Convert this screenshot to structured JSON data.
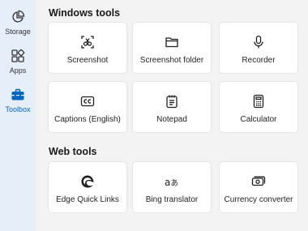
{
  "sidebar": {
    "items": [
      {
        "label": "Storage",
        "icon": "pie-chart-icon",
        "active": false
      },
      {
        "label": "Apps",
        "icon": "apps-grid-icon",
        "active": false
      },
      {
        "label": "Toolbox",
        "icon": "toolbox-icon",
        "active": true
      }
    ]
  },
  "windows_tools": {
    "title": "Windows tools",
    "tiles": [
      {
        "label": "Screenshot",
        "icon": "screenshot-icon"
      },
      {
        "label": "Screenshot folder",
        "icon": "folder-icon"
      },
      {
        "label": "Recorder",
        "icon": "microphone-icon"
      },
      {
        "label": "Captions (English)",
        "icon": "captions-icon"
      },
      {
        "label": "Notepad",
        "icon": "notepad-icon"
      },
      {
        "label": "Calculator",
        "icon": "calculator-icon"
      }
    ]
  },
  "web_tools": {
    "title": "Web tools",
    "tiles": [
      {
        "label": "Edge Quick Links",
        "icon": "edge-logo-icon"
      },
      {
        "label": "Bing translator",
        "icon": "translator-icon"
      },
      {
        "label": "Currency converter",
        "icon": "currency-icon"
      }
    ]
  },
  "colors": {
    "accent": "#0067c0",
    "sidebar_bg": "#e6eef9",
    "main_bg": "#f3f3f3",
    "tile_bg": "#ffffff"
  }
}
